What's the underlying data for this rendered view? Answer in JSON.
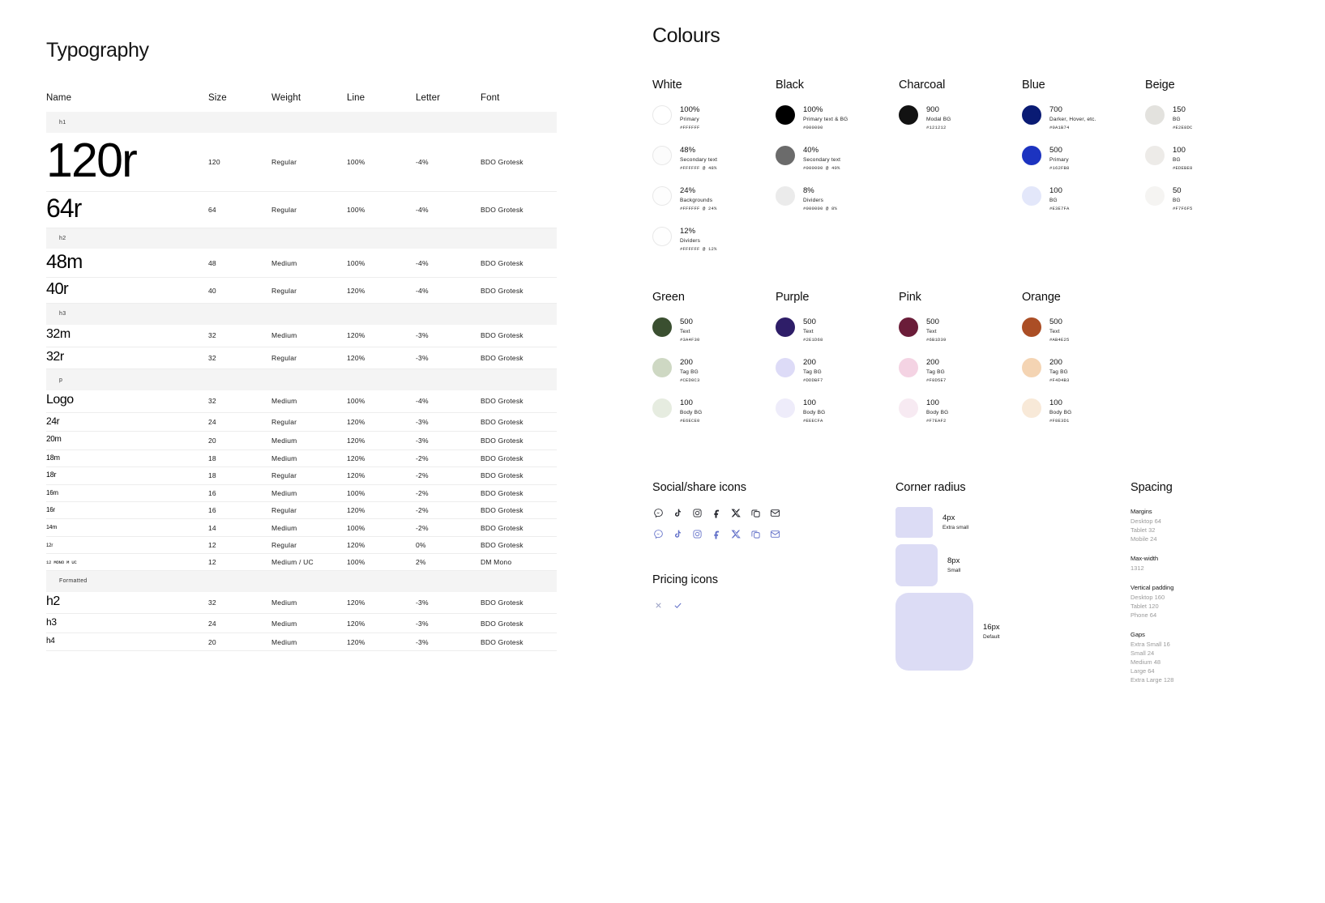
{
  "typography": {
    "title": "Typography",
    "columns": [
      "Name",
      "Size",
      "Weight",
      "Line",
      "Letter",
      "Font"
    ],
    "rows": [
      {
        "kind": "divider",
        "label": "h1"
      },
      {
        "kind": "spec",
        "name": "120r",
        "style": "s120",
        "size": "120",
        "weight": "Regular",
        "line": "100%",
        "letter": "-4%",
        "font": "BDO Grotesk"
      },
      {
        "kind": "spec",
        "name": "64r",
        "style": "s64",
        "size": "64",
        "weight": "Regular",
        "line": "100%",
        "letter": "-4%",
        "font": "BDO Grotesk"
      },
      {
        "kind": "divider",
        "label": "h2"
      },
      {
        "kind": "spec",
        "name": "48m",
        "style": "s48",
        "size": "48",
        "weight": "Medium",
        "line": "100%",
        "letter": "-4%",
        "font": "BDO Grotesk"
      },
      {
        "kind": "spec",
        "name": "40r",
        "style": "s40",
        "size": "40",
        "weight": "Regular",
        "line": "120%",
        "letter": "-4%",
        "font": "BDO Grotesk"
      },
      {
        "kind": "divider",
        "label": "h3"
      },
      {
        "kind": "spec",
        "name": "32m",
        "style": "s32m",
        "size": "32",
        "weight": "Medium",
        "line": "120%",
        "letter": "-3%",
        "font": "BDO Grotesk"
      },
      {
        "kind": "spec",
        "name": "32r",
        "style": "s32r",
        "size": "32",
        "weight": "Regular",
        "line": "120%",
        "letter": "-3%",
        "font": "BDO Grotesk"
      },
      {
        "kind": "divider",
        "label": "p"
      },
      {
        "kind": "spec",
        "name": "Logo",
        "style": "slogo",
        "size": "32",
        "weight": "Medium",
        "line": "100%",
        "letter": "-4%",
        "font": "BDO Grotesk"
      },
      {
        "kind": "spec",
        "name": "24r",
        "style": "s24",
        "size": "24",
        "weight": "Regular",
        "line": "120%",
        "letter": "-3%",
        "font": "BDO Grotesk"
      },
      {
        "kind": "spec",
        "name": "20m",
        "style": "s20",
        "size": "20",
        "weight": "Medium",
        "line": "120%",
        "letter": "-3%",
        "font": "BDO Grotesk"
      },
      {
        "kind": "spec",
        "name": "18m",
        "style": "s18m",
        "size": "18",
        "weight": "Medium",
        "line": "120%",
        "letter": "-2%",
        "font": "BDO Grotesk"
      },
      {
        "kind": "spec",
        "name": "18r",
        "style": "s18r",
        "size": "18",
        "weight": "Regular",
        "line": "120%",
        "letter": "-2%",
        "font": "BDO Grotesk"
      },
      {
        "kind": "spec",
        "name": "16m",
        "style": "s16m",
        "size": "16",
        "weight": "Medium",
        "line": "100%",
        "letter": "-2%",
        "font": "BDO Grotesk"
      },
      {
        "kind": "spec",
        "name": "16r",
        "style": "s16r",
        "size": "16",
        "weight": "Regular",
        "line": "120%",
        "letter": "-2%",
        "font": "BDO Grotesk"
      },
      {
        "kind": "spec",
        "name": "14m",
        "style": "s14m",
        "size": "14",
        "weight": "Medium",
        "line": "100%",
        "letter": "-2%",
        "font": "BDO Grotesk"
      },
      {
        "kind": "spec",
        "name": "12r",
        "style": "s12r",
        "size": "12",
        "weight": "Regular",
        "line": "120%",
        "letter": "0%",
        "font": "BDO Grotesk"
      },
      {
        "kind": "spec",
        "name": "12 MONO M UC",
        "style": "smono",
        "size": "12",
        "weight": "Medium / UC",
        "line": "100%",
        "letter": "2%",
        "font": "DM Mono"
      },
      {
        "kind": "divider",
        "label": "Formatted"
      },
      {
        "kind": "spec",
        "name": "h2",
        "style": "sh2",
        "size": "32",
        "weight": "Medium",
        "line": "120%",
        "letter": "-3%",
        "font": "BDO Grotesk"
      },
      {
        "kind": "spec",
        "name": "h3",
        "style": "sh3",
        "size": "24",
        "weight": "Medium",
        "line": "120%",
        "letter": "-3%",
        "font": "BDO Grotesk"
      },
      {
        "kind": "spec",
        "name": "h4",
        "style": "sh4",
        "size": "20",
        "weight": "Medium",
        "line": "120%",
        "letter": "-3%",
        "font": "BDO Grotesk"
      }
    ]
  },
  "colours": {
    "title": "Colours",
    "row1": [
      {
        "name": "White",
        "swatches": [
          {
            "level": "100%",
            "use": "Primary",
            "hex": "#FFFFFF",
            "fill": "#FFFFFF",
            "ring": true
          },
          {
            "level": "48%",
            "use": "Secondary text",
            "hex": "#FFFFFF @ 48%",
            "fill": "#FCFCFC",
            "ring": true
          },
          {
            "level": "24%",
            "use": "Backgrounds",
            "hex": "#FFFFFF @ 24%",
            "fill": "#FDFDFD",
            "ring": true
          },
          {
            "level": "12%",
            "use": "Dividers",
            "hex": "#FFFFFF @ 12%",
            "fill": "#FEFEFE",
            "ring": true
          }
        ]
      },
      {
        "name": "Black",
        "swatches": [
          {
            "level": "100%",
            "use": "Primary text & BG",
            "hex": "#000000",
            "fill": "#000000",
            "ring": false
          },
          {
            "level": "40%",
            "use": "Secondary text",
            "hex": "#000000 @ 40%",
            "fill": "#6b6b6b",
            "ring": false
          },
          {
            "level": "8%",
            "use": "Dividers",
            "hex": "#000000 @ 8%",
            "fill": "#ebebeb",
            "ring": false
          }
        ]
      },
      {
        "name": "Charcoal",
        "swatches": [
          {
            "level": "900",
            "use": "Modal BG",
            "hex": "#121212",
            "fill": "#121212",
            "ring": false
          }
        ]
      },
      {
        "name": "Blue",
        "swatches": [
          {
            "level": "700",
            "use": "Darker, Hover, etc.",
            "hex": "#0A1B74",
            "fill": "#0A1B74",
            "ring": false
          },
          {
            "level": "500",
            "use": "Primary",
            "hex": "#162FB8",
            "fill": "#1c33c0",
            "ring": false
          },
          {
            "level": "100",
            "use": "BG",
            "hex": "#E3E7FA",
            "fill": "#E3E7FA",
            "ring": false
          }
        ]
      },
      {
        "name": "Beige",
        "swatches": [
          {
            "level": "150",
            "use": "BG",
            "hex": "#E2E8DC",
            "fill": "#e3e2de",
            "ring": false
          },
          {
            "level": "100",
            "use": "BG",
            "hex": "#EDEBE8",
            "fill": "#edebe8",
            "ring": false
          },
          {
            "level": "50",
            "use": "BG",
            "hex": "#F7F6F5",
            "fill": "#f5f4f2",
            "ring": false
          }
        ]
      }
    ],
    "row2": [
      {
        "name": "Green",
        "swatches": [
          {
            "level": "500",
            "use": "Text",
            "hex": "#3A4F30",
            "fill": "#3A4F30",
            "ring": false
          },
          {
            "level": "200",
            "use": "Tag BG",
            "hex": "#CED8C3",
            "fill": "#CED8C3",
            "ring": false
          },
          {
            "level": "100",
            "use": "Body BG",
            "hex": "#E6ECE0",
            "fill": "#E6ECE0",
            "ring": false
          }
        ]
      },
      {
        "name": "Purple",
        "swatches": [
          {
            "level": "500",
            "use": "Text",
            "hex": "#2E1D68",
            "fill": "#2E1D68",
            "ring": false
          },
          {
            "level": "200",
            "use": "Tag BG",
            "hex": "#DDDBF7",
            "fill": "#DDDBF7",
            "ring": false
          },
          {
            "level": "100",
            "use": "Body BG",
            "hex": "#EEECFA",
            "fill": "#EEECFA",
            "ring": false
          }
        ]
      },
      {
        "name": "Pink",
        "swatches": [
          {
            "level": "500",
            "use": "Text",
            "hex": "#6B1D39",
            "fill": "#6B1D39",
            "ring": false
          },
          {
            "level": "200",
            "use": "Tag BG",
            "hex": "#F8D5E7",
            "fill": "#f4d3e3",
            "ring": false
          },
          {
            "level": "100",
            "use": "Body BG",
            "hex": "#F7EAF2",
            "fill": "#F7EAF2",
            "ring": false
          }
        ]
      },
      {
        "name": "Orange",
        "swatches": [
          {
            "level": "500",
            "use": "Text",
            "hex": "#AB4E25",
            "fill": "#AB4E25",
            "ring": false
          },
          {
            "level": "200",
            "use": "Tag BG",
            "hex": "#F4D4B3",
            "fill": "#F4D4B3",
            "ring": false
          },
          {
            "level": "100",
            "use": "Body BG",
            "hex": "#F8E3D1",
            "fill": "#f8e9d8",
            "ring": false
          }
        ]
      }
    ]
  },
  "social": {
    "title": "Social/share icons",
    "icon_names": [
      "messenger-icon",
      "tiktok-icon",
      "instagram-icon",
      "facebook-icon",
      "x-twitter-icon",
      "copy-link-icon",
      "email-icon"
    ],
    "row_colors": [
      "#22242b",
      "#6270c8"
    ]
  },
  "pricing": {
    "title": "Pricing icons",
    "icon_names": [
      "cross-icon",
      "check-icon"
    ],
    "colors": [
      "#9aa0c4",
      "#6270c8"
    ]
  },
  "corner_radius": {
    "title": "Corner radius",
    "swatch_color": "#dcdcf5",
    "items": [
      {
        "value": "4px",
        "name": "Extra small",
        "cls": "r-4"
      },
      {
        "value": "8px",
        "name": "Small",
        "cls": "r-8"
      },
      {
        "value": "16px",
        "name": "Default",
        "cls": "r-16"
      }
    ]
  },
  "spacing": {
    "title": "Spacing",
    "groups": [
      {
        "head": "Margins",
        "items": [
          "Desktop 64",
          "Tablet 32",
          "Mobile 24"
        ]
      },
      {
        "head": "Max-width",
        "items": [
          "1312"
        ]
      },
      {
        "head": "Vertical padding",
        "items": [
          "Desktop 160",
          "Tablet 120",
          "Phone 64"
        ]
      },
      {
        "head": "Gaps",
        "items": [
          "Extra Small 16",
          "Small 24",
          "Medium 48",
          "Large 64",
          "Extra Large 128"
        ]
      }
    ]
  }
}
